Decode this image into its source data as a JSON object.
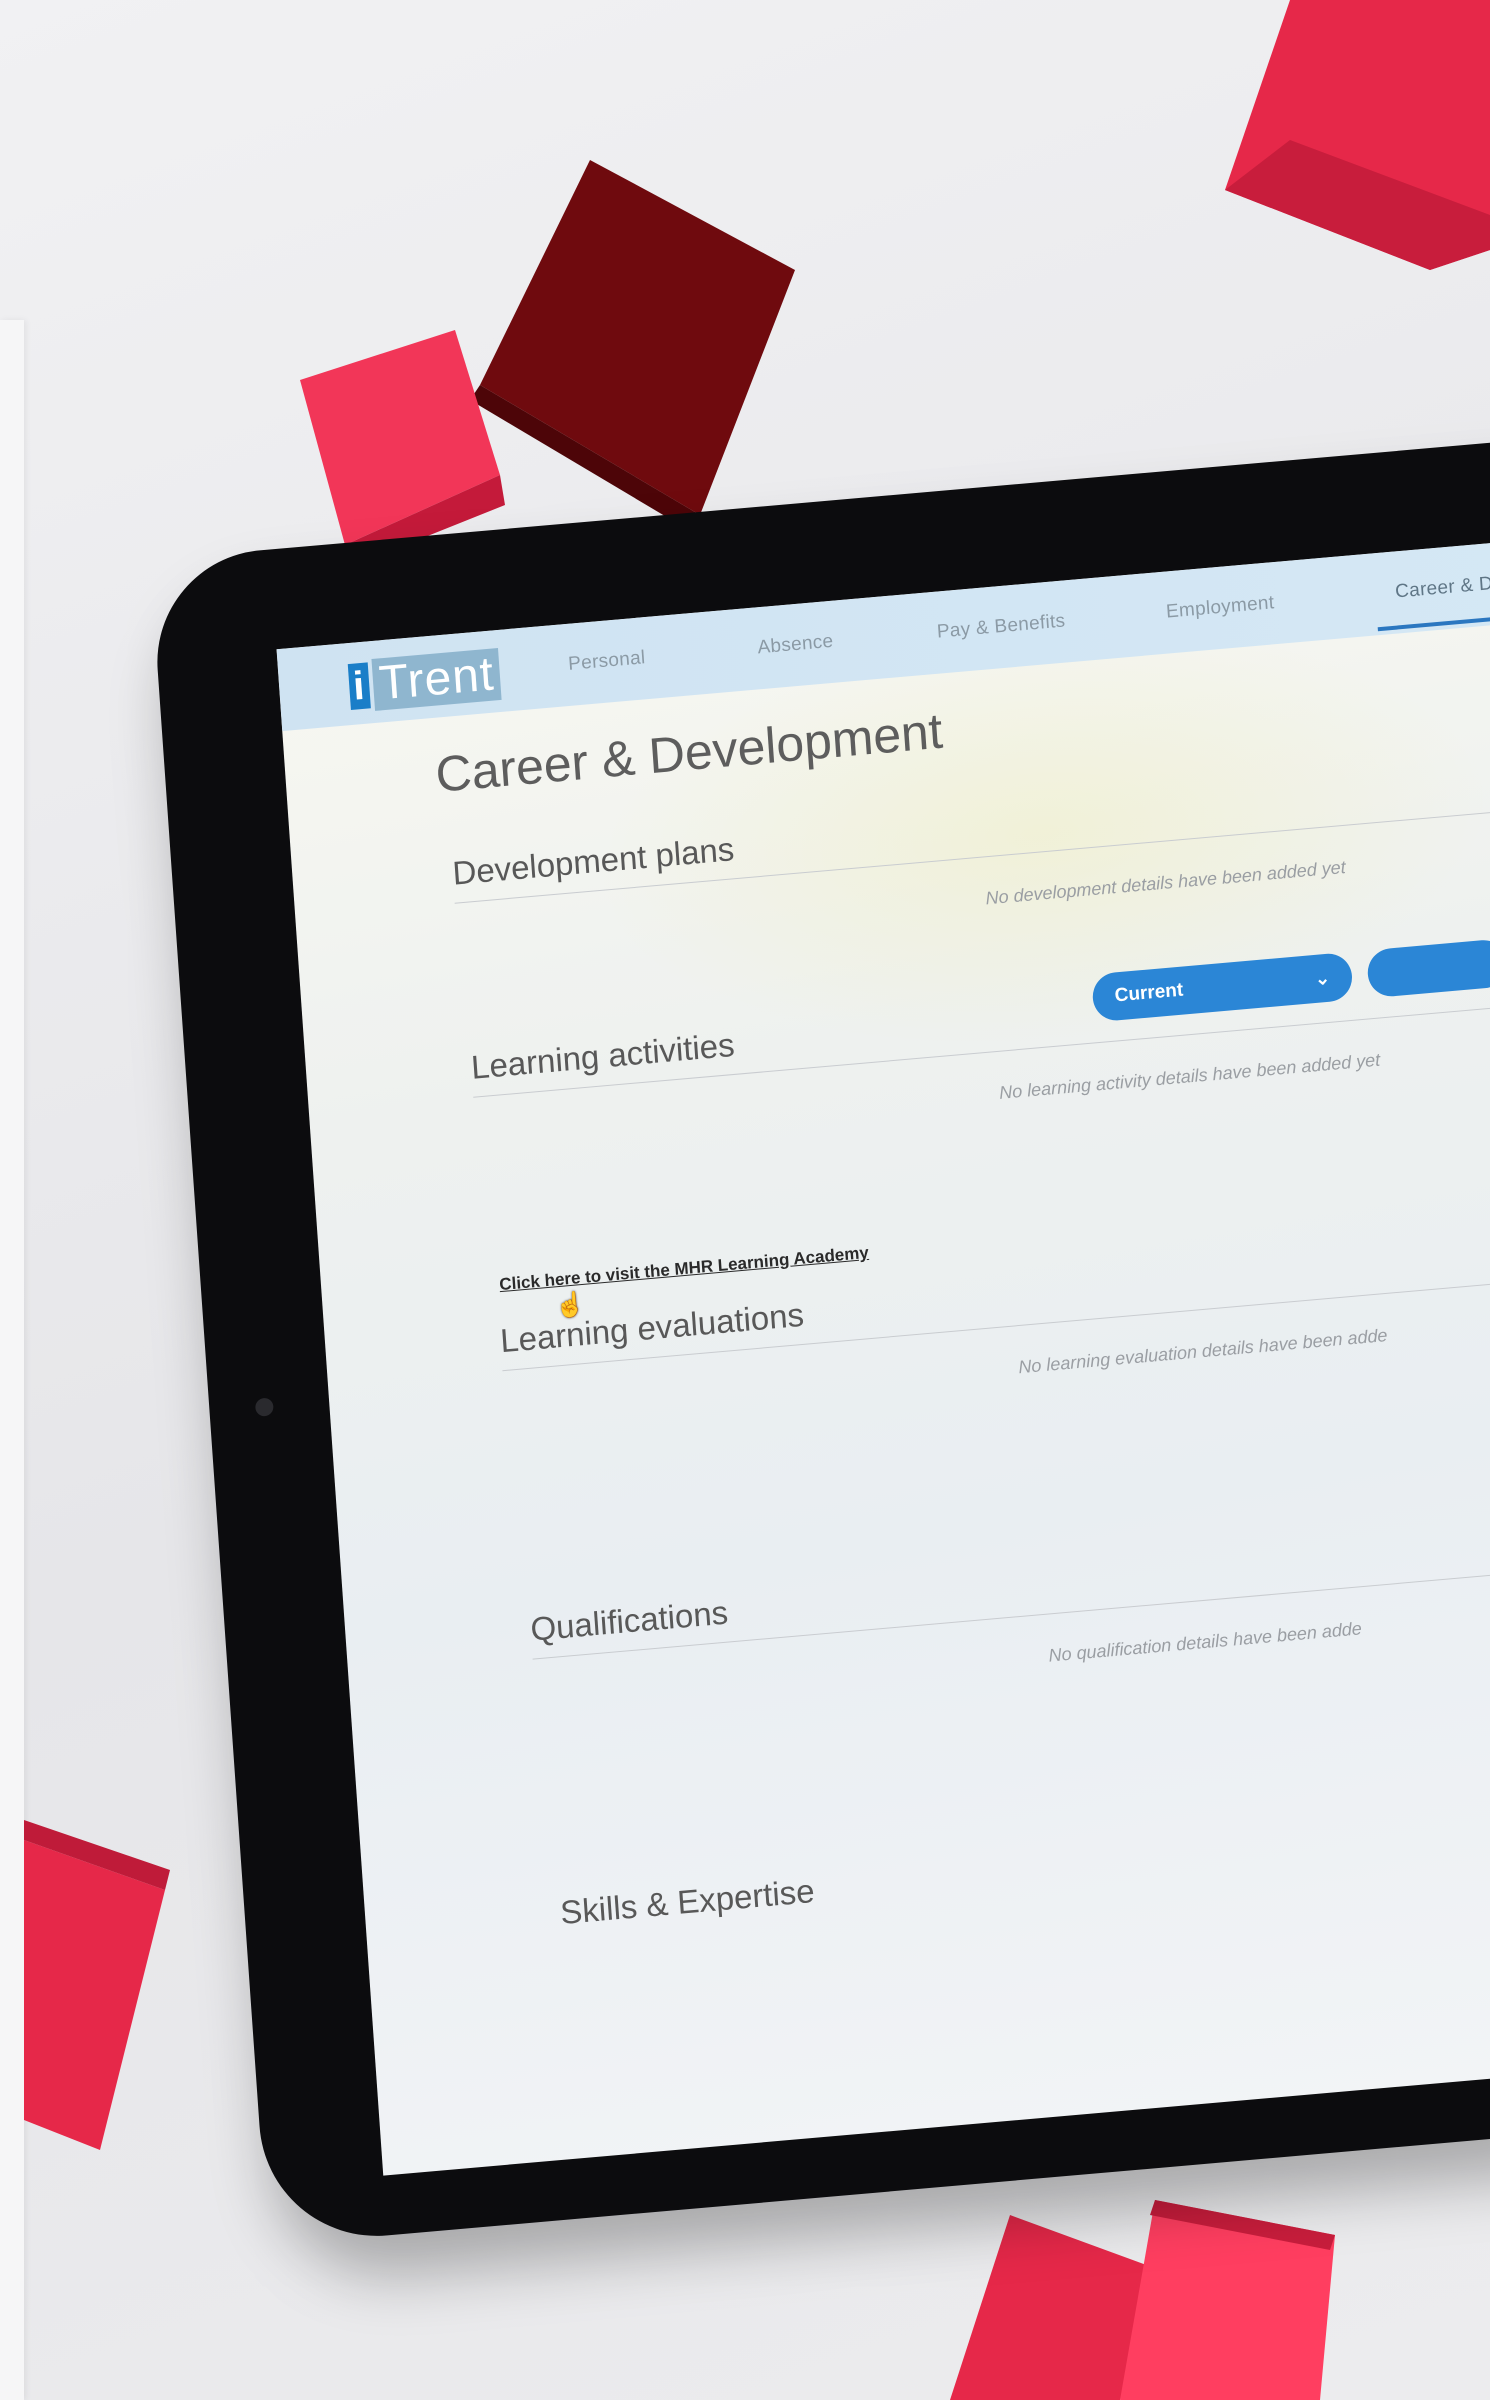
{
  "app": {
    "logo_i": "i",
    "logo_word": "Trent"
  },
  "nav": {
    "tabs": [
      {
        "label": "Personal"
      },
      {
        "label": "Absence"
      },
      {
        "label": "Pay & Benefits"
      },
      {
        "label": "Employment"
      },
      {
        "label": "Career & Development",
        "active": true
      }
    ]
  },
  "page": {
    "title": "Career & Development"
  },
  "sections": {
    "development_plans": {
      "title": "Development plans",
      "empty_message": "No development details have been added yet"
    },
    "learning_activities": {
      "title": "Learning activities",
      "filter_value": "Current",
      "empty_message": "No learning activity details have been added yet"
    },
    "academy_link": "Click here to visit the MHR Learning Academy",
    "learning_evaluations": {
      "title": "Learning evaluations",
      "empty_message": "No learning evaluation details have been adde"
    },
    "qualifications": {
      "title": "Qualifications",
      "empty_message": "No qualification details have been adde"
    },
    "skills": {
      "title": "Skills & Expertise"
    }
  },
  "colors": {
    "accent": "#2b86d6",
    "nav_bg": "#d0e4f3",
    "cube_red": "#e8254a",
    "cube_dark": "#7a0a0f"
  }
}
